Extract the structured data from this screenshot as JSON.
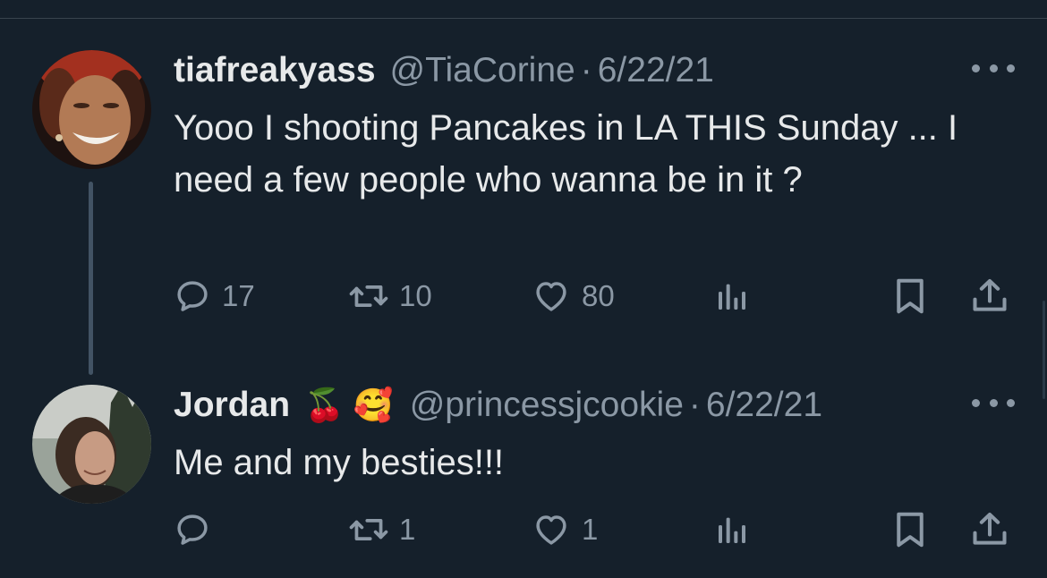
{
  "tweets": [
    {
      "display_name": "tiafreakyass",
      "emojis": [],
      "handle": "@TiaCorine",
      "separator": "·",
      "date": "6/22/21",
      "text": "Yooo I shooting Pancakes in LA THIS Sunday ... I need a few people who wanna be in it ?",
      "counts": {
        "replies": "17",
        "retweets": "10",
        "likes": "80"
      }
    },
    {
      "display_name": "Jordan",
      "emojis": [
        "🍒",
        "🥰"
      ],
      "handle": "@princessjcookie",
      "separator": "·",
      "date": "6/22/21",
      "text": "Me and my besties!!!",
      "counts": {
        "replies": "",
        "retweets": "1",
        "likes": "1"
      }
    }
  ],
  "icons": [
    "reply-icon",
    "retweet-icon",
    "like-icon",
    "views-icon",
    "bookmark-icon",
    "share-icon",
    "more-icon"
  ],
  "colors": {
    "background": "#15202b",
    "text_primary": "#e7e9ea",
    "text_secondary": "#8b98a5",
    "thread_line": "#425364"
  }
}
